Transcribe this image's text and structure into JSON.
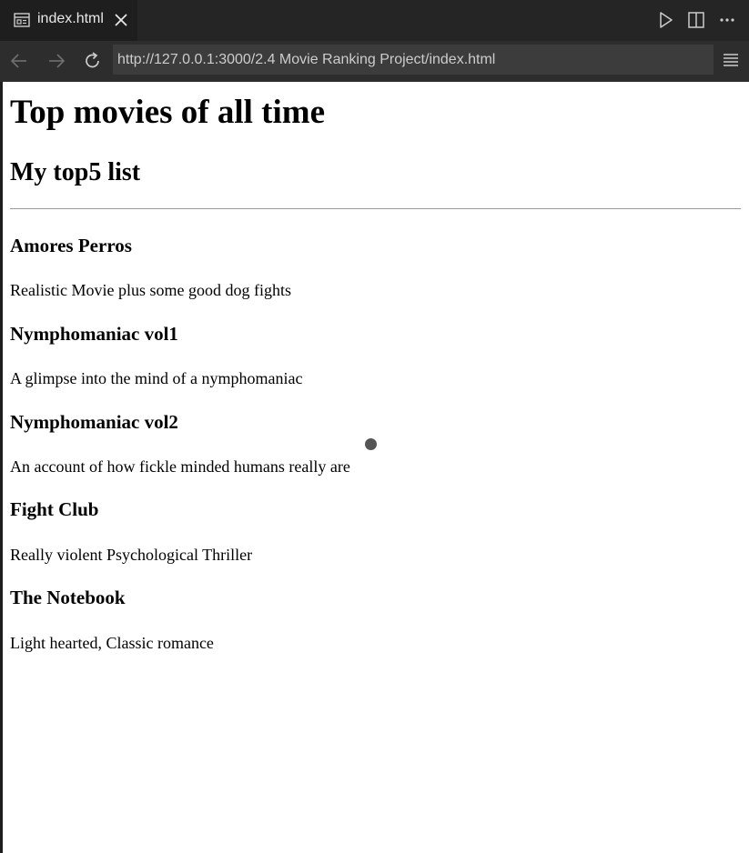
{
  "tab": {
    "label": "index.html"
  },
  "address_bar": {
    "url": "http://127.0.0.1:3000/2.4 Movie Ranking Project/index.html"
  },
  "page": {
    "heading": "Top movies of all time",
    "subheading": "My top5 list",
    "movies": [
      {
        "title": "Amores Perros",
        "description": "Realistic Movie plus some good dog fights"
      },
      {
        "title": "Nymphomaniac vol1",
        "description": "A glimpse into the mind of a nymphomaniac"
      },
      {
        "title": "Nymphomaniac vol2",
        "description": "An account of how fickle minded humans really are"
      },
      {
        "title": "Fight Club",
        "description": "Really violent Psychological Thriller"
      },
      {
        "title": "The Notebook",
        "description": "Light hearted, Classic romance"
      }
    ]
  }
}
